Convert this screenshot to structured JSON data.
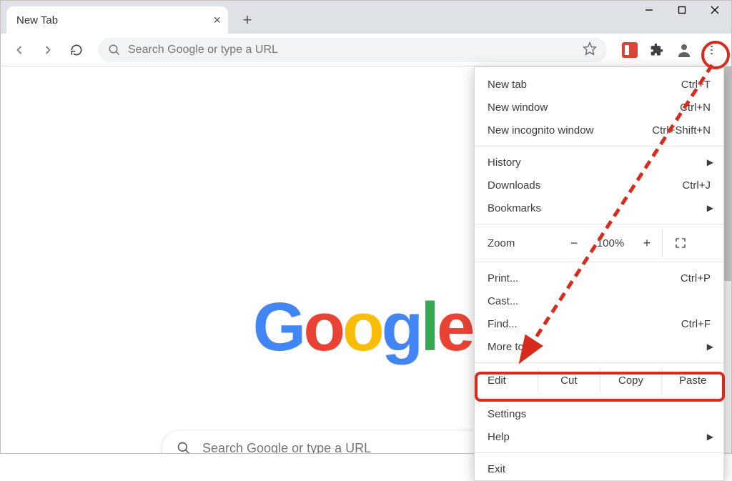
{
  "tab": {
    "title": "New Tab"
  },
  "omnibox": {
    "placeholder": "Search Google or type a URL"
  },
  "page_search": {
    "placeholder": "Search Google or type a URL"
  },
  "logo": {
    "g1": "G",
    "o1": "o",
    "o2": "o",
    "g2": "g",
    "l": "l",
    "e": "e"
  },
  "menu": {
    "new_tab": "New tab",
    "new_tab_sc": "Ctrl+T",
    "new_window": "New window",
    "new_window_sc": "Ctrl+N",
    "incognito": "New incognito window",
    "incognito_sc": "Ctrl+Shift+N",
    "history": "History",
    "downloads": "Downloads",
    "downloads_sc": "Ctrl+J",
    "bookmarks": "Bookmarks",
    "zoom_label": "Zoom",
    "zoom_minus": "−",
    "zoom_value": "100%",
    "zoom_plus": "+",
    "print": "Print...",
    "print_sc": "Ctrl+P",
    "cast": "Cast...",
    "find": "Find...",
    "find_sc": "Ctrl+F",
    "more_tools": "More tools",
    "edit_label": "Edit",
    "cut": "Cut",
    "copy": "Copy",
    "paste": "Paste",
    "settings": "Settings",
    "help": "Help",
    "exit": "Exit"
  }
}
